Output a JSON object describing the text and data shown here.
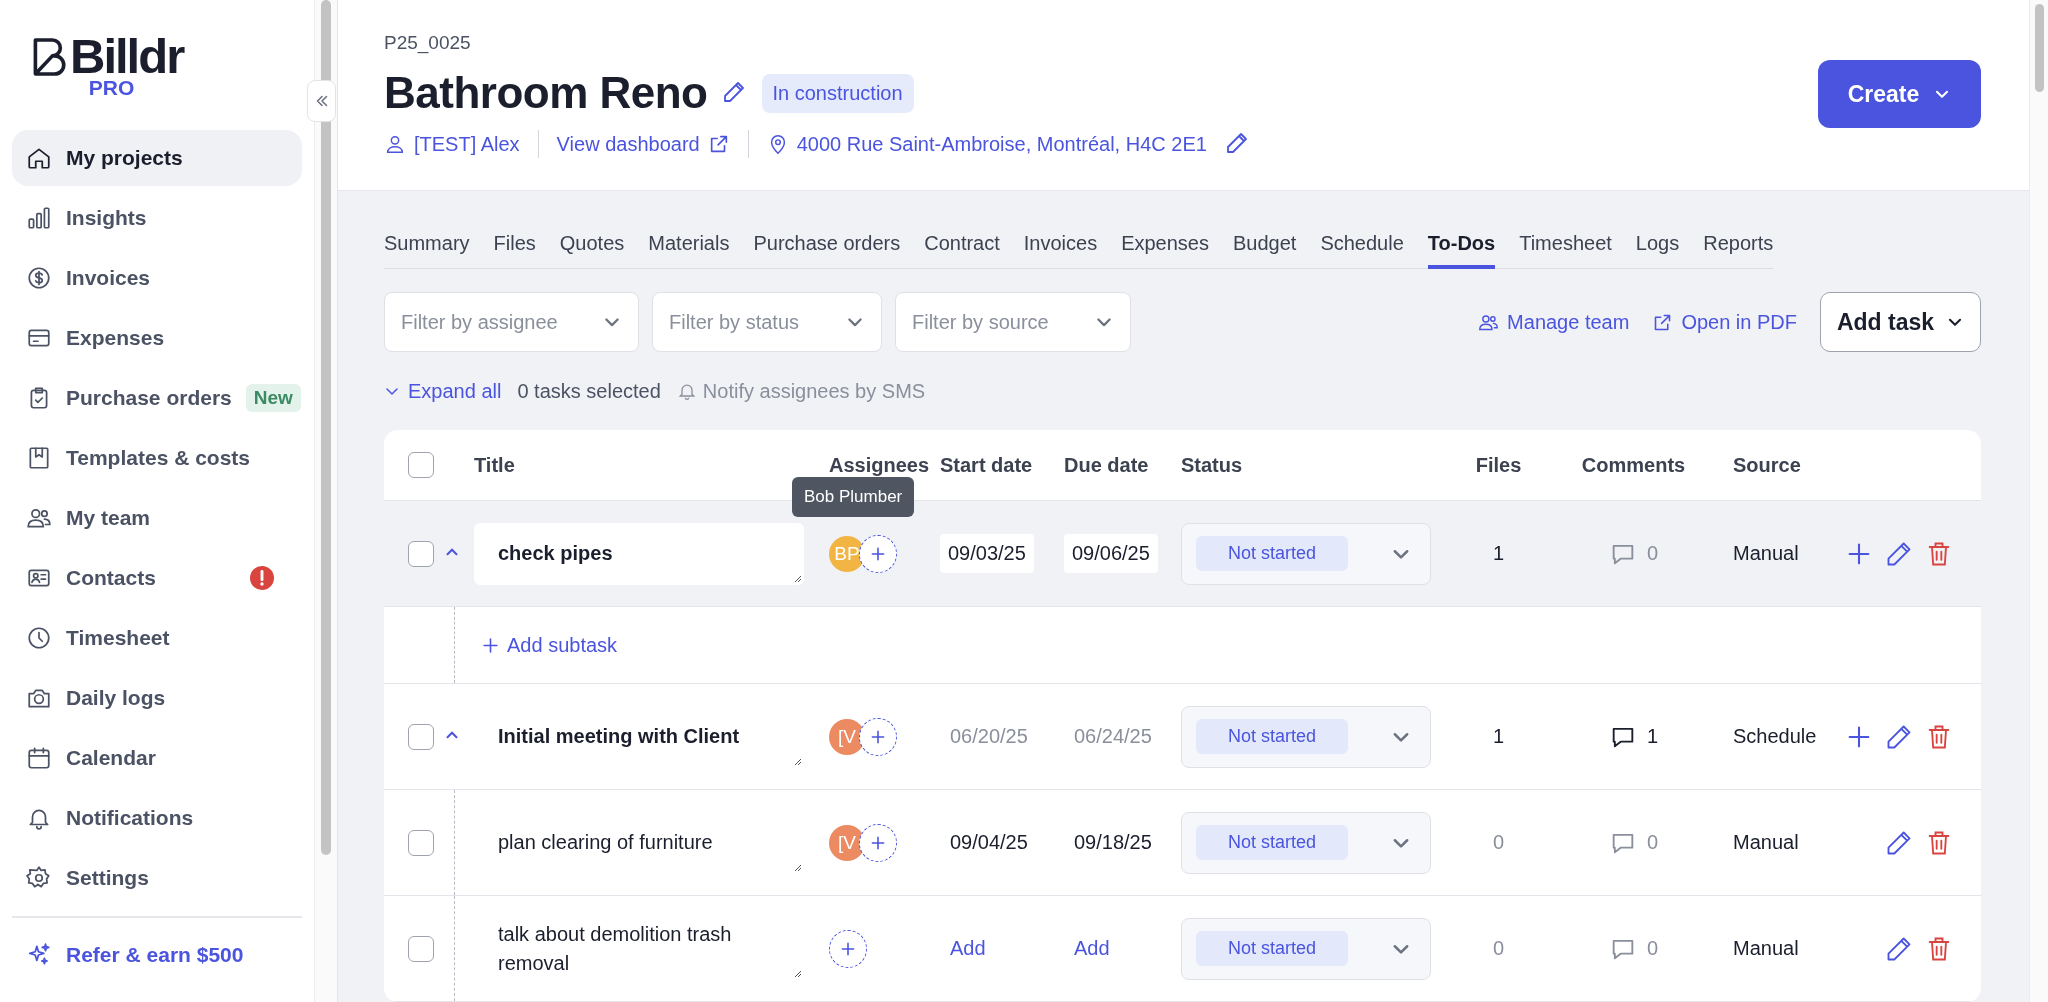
{
  "sidebar": {
    "logo": {
      "name": "Billdr",
      "tier": "PRO"
    },
    "items": [
      {
        "label": "My projects",
        "selected": true,
        "alert": false
      },
      {
        "label": "Insights",
        "selected": false,
        "alert": false
      },
      {
        "label": "Invoices",
        "selected": false,
        "alert": false
      },
      {
        "label": "Expenses",
        "selected": false,
        "alert": false
      },
      {
        "label": "Purchase orders",
        "badge": "New",
        "selected": false,
        "alert": false
      },
      {
        "label": "Templates & costs",
        "selected": false,
        "alert": false
      },
      {
        "label": "My team",
        "selected": false,
        "alert": false
      },
      {
        "label": "Contacts",
        "selected": false,
        "alert": true
      },
      {
        "label": "Timesheet",
        "selected": false,
        "alert": false
      },
      {
        "label": "Daily logs",
        "selected": false,
        "alert": false
      },
      {
        "label": "Calendar",
        "selected": false,
        "alert": false
      },
      {
        "label": "Notifications",
        "selected": false,
        "alert": false
      },
      {
        "label": "Settings",
        "selected": false,
        "alert": false
      }
    ],
    "footer_link": "Refer & earn $500"
  },
  "project": {
    "code": "P25_0025",
    "name": "Bathroom Reno",
    "status": "In construction",
    "client": "[TEST] Alex",
    "dashboard_link": "View dashboard",
    "address": "4000 Rue Saint-Ambroise, Montréal, H4C 2E1"
  },
  "create_button": "Create",
  "tabs": [
    {
      "label": "Summary",
      "selected": false
    },
    {
      "label": "Files",
      "selected": false
    },
    {
      "label": "Quotes",
      "selected": false
    },
    {
      "label": "Materials",
      "selected": false
    },
    {
      "label": "Purchase orders",
      "selected": false
    },
    {
      "label": "Contract",
      "selected": false
    },
    {
      "label": "Invoices",
      "selected": false
    },
    {
      "label": "Expenses",
      "selected": false
    },
    {
      "label": "Budget",
      "selected": false
    },
    {
      "label": "Schedule",
      "selected": false
    },
    {
      "label": "To-Dos",
      "selected": true
    },
    {
      "label": "Timesheet",
      "selected": false
    },
    {
      "label": "Logs",
      "selected": false
    },
    {
      "label": "Reports",
      "selected": false
    }
  ],
  "filters": [
    {
      "placeholder": "Filter by assignee"
    },
    {
      "placeholder": "Filter by status"
    },
    {
      "placeholder": "Filter by source"
    }
  ],
  "manage_team": "Manage team",
  "open_pdf": "Open in PDF",
  "add_task": "Add task",
  "expand_all": "Expand all",
  "selected_count": "0 tasks selected",
  "notify": {
    "label": "Notify assignees by SMS",
    "disabled": true
  },
  "table": {
    "columns": [
      "Title",
      "Assignees",
      "Start date",
      "Due date",
      "Status",
      "Files",
      "Comments",
      "Source"
    ],
    "all_selected": false,
    "tasks": [
      {
        "title": "check pipes",
        "selected": false,
        "expanded": true,
        "highlighted": true,
        "assignees": [
          {
            "initials": "BP",
            "color": "#f2b544"
          }
        ],
        "tooltip": "Bob Plumber",
        "start_date": {
          "text": "09/03/25",
          "kind": "input"
        },
        "due_date": {
          "text": "09/06/25",
          "kind": "input"
        },
        "status": "Not started",
        "files": {
          "text": "1",
          "muted": false
        },
        "comments": {
          "count": "0",
          "unread": false
        },
        "source": "Manual",
        "can_add_subtask": true,
        "add_subtask": "Add subtask"
      },
      {
        "title": "Initial meeting with Client",
        "selected": false,
        "expanded": true,
        "highlighted": false,
        "assignees": [
          {
            "initials": "[V",
            "color": "#ec8a62"
          }
        ],
        "start_date": {
          "text": "06/20/25",
          "kind": "locked"
        },
        "due_date": {
          "text": "06/24/25",
          "kind": "locked"
        },
        "status": "Not started",
        "files": {
          "text": "1",
          "muted": false
        },
        "comments": {
          "count": "1",
          "unread": true
        },
        "source": "Schedule",
        "can_add_subtask": true,
        "children": [
          {
            "title": "plan clearing of furniture",
            "selected": false,
            "highlighted": false,
            "assignees": [
              {
                "initials": "[V",
                "color": "#ec8a62"
              }
            ],
            "start_date": {
              "text": "09/04/25",
              "kind": "plain"
            },
            "due_date": {
              "text": "09/18/25",
              "kind": "plain"
            },
            "status": "Not started",
            "files": {
              "text": "0",
              "muted": true
            },
            "comments": {
              "count": "0",
              "unread": false
            },
            "source": "Manual",
            "can_add_subtask": false
          },
          {
            "title": "talk about demolition trash removal",
            "selected": false,
            "highlighted": false,
            "start_date": {
              "text": "Add",
              "kind": "link"
            },
            "due_date": {
              "text": "Add",
              "kind": "link"
            },
            "status": "Not started",
            "files": {
              "text": "0",
              "muted": true
            },
            "comments": {
              "count": "0",
              "unread": false
            },
            "source": "Manual",
            "can_add_subtask": false
          }
        ]
      }
    ]
  }
}
